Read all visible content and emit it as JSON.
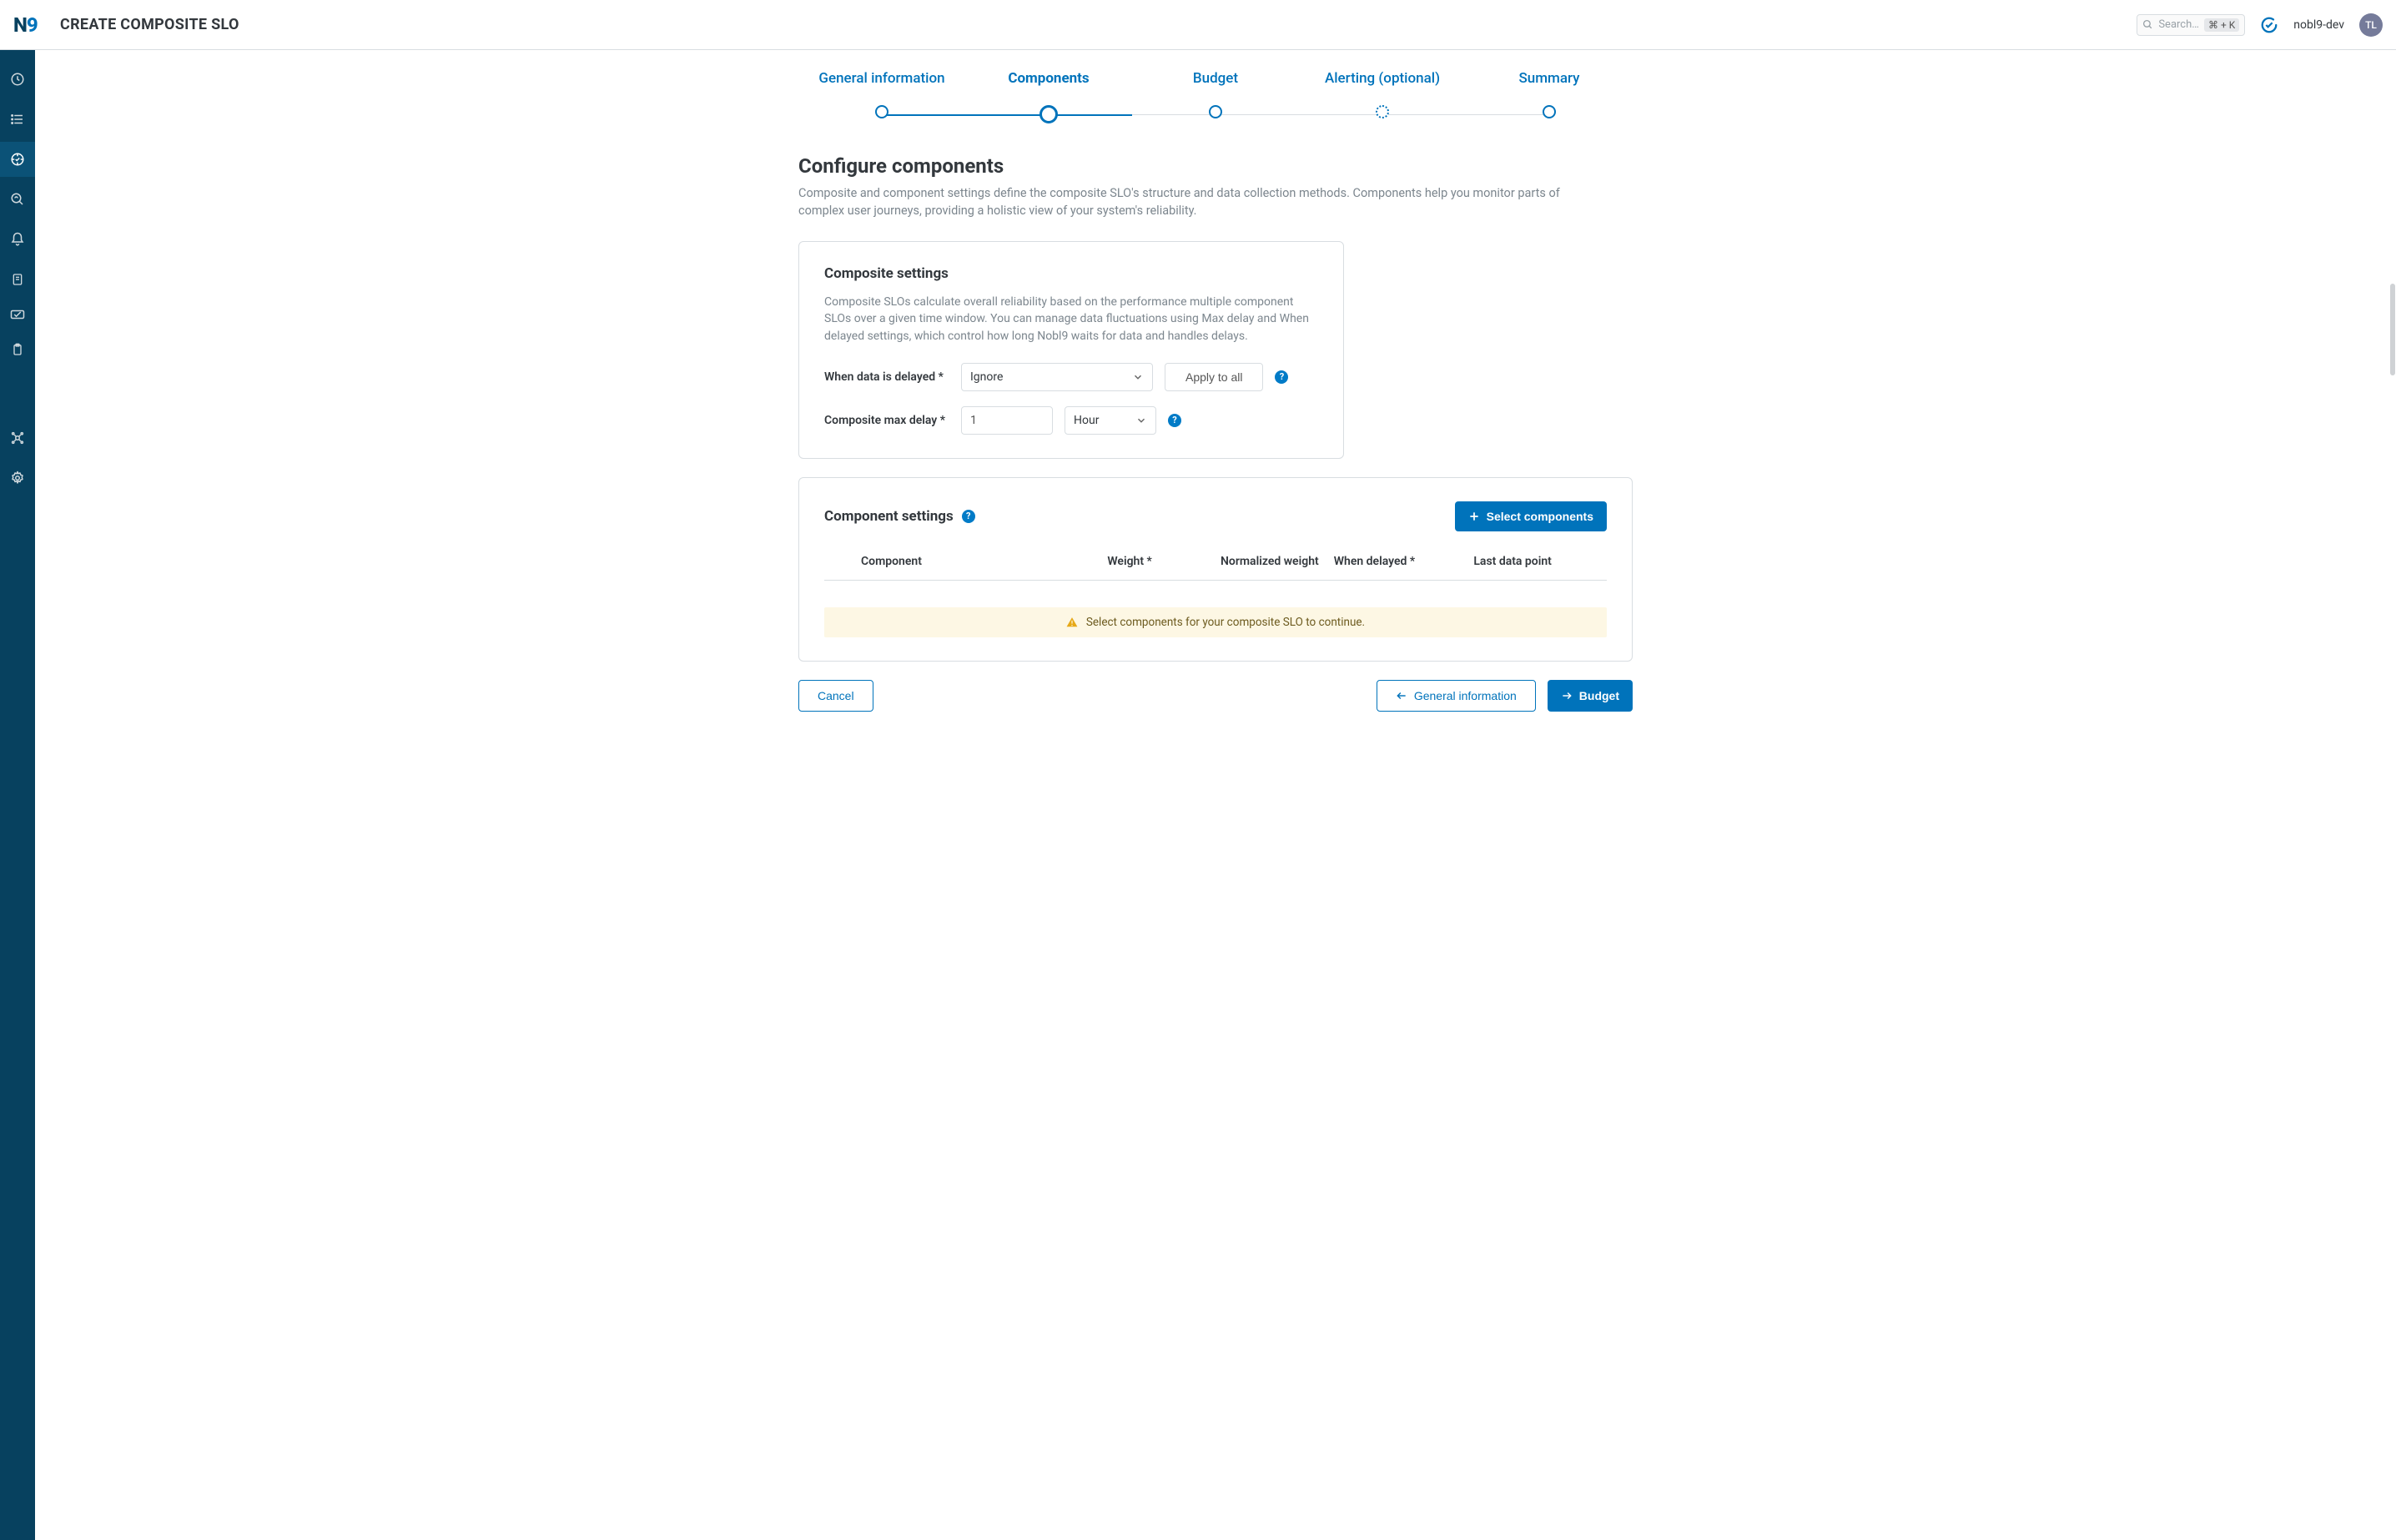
{
  "header": {
    "logo_n": "N",
    "logo_9": "9",
    "title": "CREATE COMPOSITE SLO",
    "search_placeholder": "Search…",
    "search_kbd": "⌘ + K",
    "org": "nobl9-dev",
    "avatar": "TL"
  },
  "stepper": {
    "steps": [
      {
        "label": "General information"
      },
      {
        "label": "Components"
      },
      {
        "label": "Budget"
      },
      {
        "label": "Alerting (optional)"
      },
      {
        "label": "Summary"
      }
    ],
    "active_index": 1
  },
  "section": {
    "title": "Configure components",
    "desc": "Composite and component settings define the composite SLO's structure and data collection methods. Components help you monitor parts of complex user journeys, providing a holistic view of your system's reliability."
  },
  "composite_settings": {
    "title": "Composite settings",
    "desc": "Composite SLOs calculate overall reliability based on the performance multiple component SLOs over a given time window. You can manage data fluctuations using Max delay and When delayed settings, which control how long Nobl9 waits for data and handles delays.",
    "when_delayed_label": "When data is delayed *",
    "when_delayed_value": "Ignore",
    "apply_all_label": "Apply to all",
    "max_delay_label": "Composite max delay *",
    "max_delay_value": "1",
    "max_delay_unit": "Hour"
  },
  "component_settings": {
    "title": "Component settings",
    "select_button": "Select components",
    "columns": {
      "component": "Component",
      "weight": "Weight *",
      "norm_weight": "Normalized weight",
      "when_delayed": "When delayed *",
      "last_point": "Last data point"
    },
    "warning": "Select components for your composite SLO to continue."
  },
  "footer": {
    "cancel": "Cancel",
    "back": "General information",
    "next": "Budget"
  }
}
